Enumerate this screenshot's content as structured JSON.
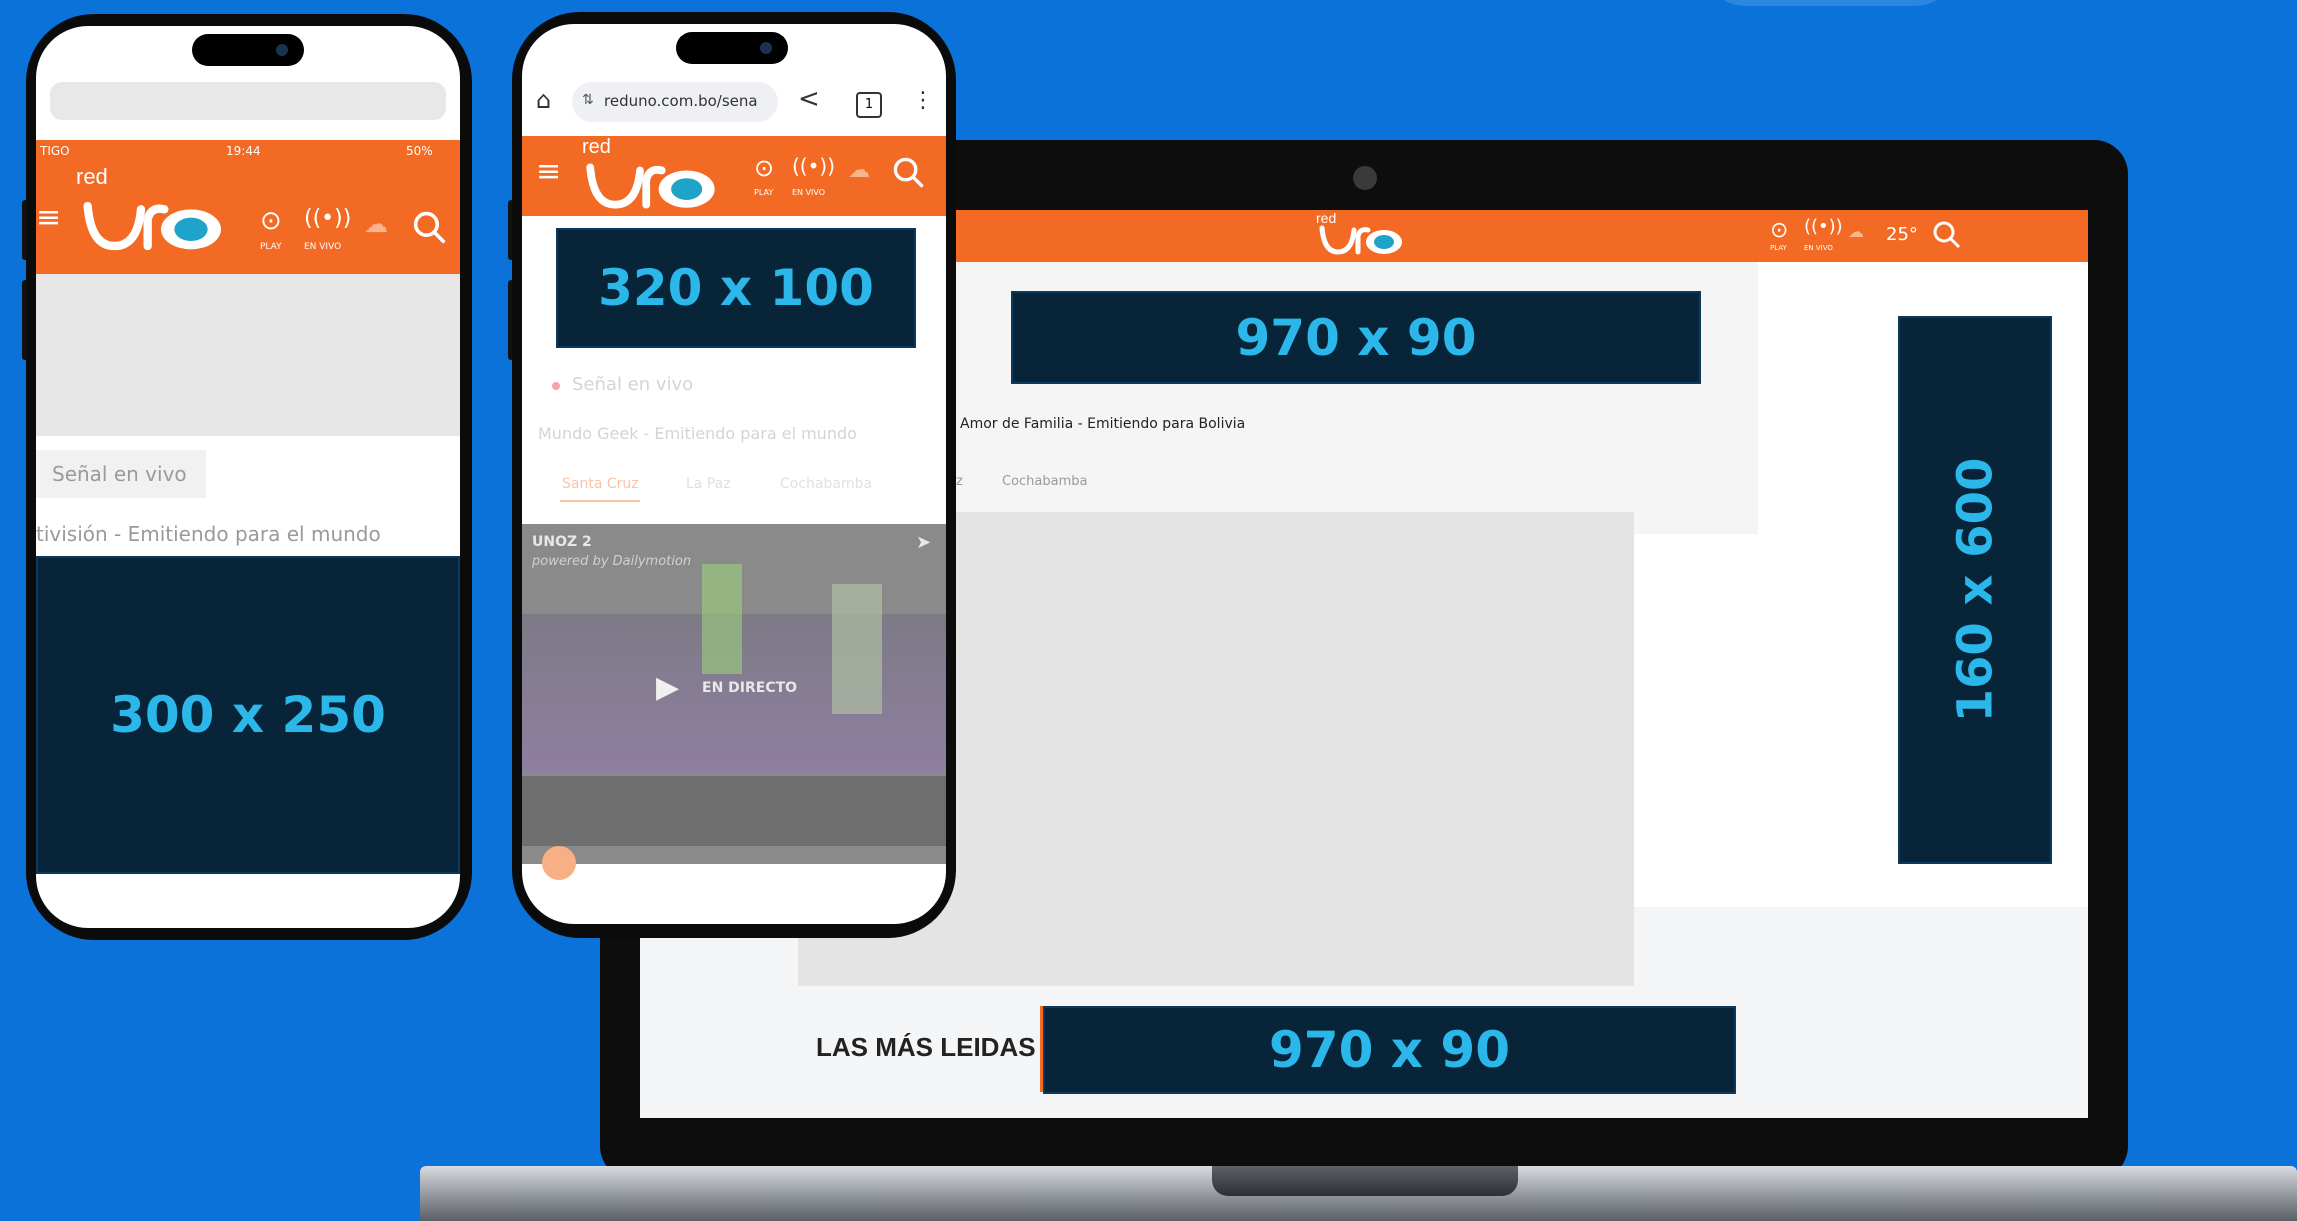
{
  "ads": {
    "laptop_top": "970 x 90",
    "laptop_bottom": "970 x 90",
    "laptop_side": "160 x 600",
    "phone_left": "300 x 250",
    "phone_mid": "320 x 100"
  },
  "laptop": {
    "logo_small": "red",
    "weather": "25°",
    "play_label": "PLAY",
    "live_label": "EN VIVO",
    "subtitle": "Amor de Familia - Emitiendo para Bolivia",
    "city_tab": "Cochabamba",
    "tab_partial": "z",
    "section_title": "LAS MÁS LEIDAS"
  },
  "phone_left": {
    "carrier": "TIGO",
    "time": "19:44",
    "battery": "50%",
    "logo_small": "red",
    "play_label": "PLAY",
    "live_label": "EN VIVO",
    "live_signal": "Señal en vivo",
    "subtitle": "tivisión - Emitiendo para el mundo"
  },
  "phone_mid": {
    "url": "reduno.com.bo/sena",
    "tab_count": "1",
    "logo_small": "red",
    "play_label": "PLAY",
    "live_label": "EN VIVO",
    "live_signal": "Señal en vivo",
    "subtitle": "Mundo Geek - Emitiendo para el mundo",
    "tabs": [
      "Santa Cruz",
      "La Paz",
      "Cochabamba"
    ],
    "video_title": "UNOZ 2",
    "video_powered": "powered by Dailymotion",
    "video_live": "EN DIRECTO"
  },
  "colors": {
    "background": "#0a72d9",
    "brand_orange": "#f26a24",
    "ad_fill": "#072438",
    "ad_text": "#2bb7ea"
  }
}
